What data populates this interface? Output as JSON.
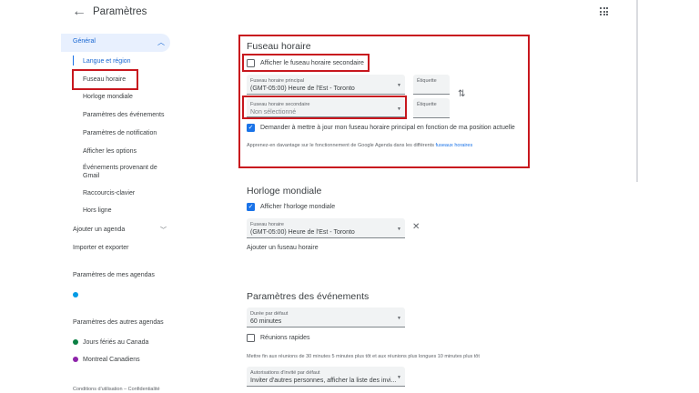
{
  "header": {
    "title": "Paramètres",
    "back_icon": "arrow-left-icon",
    "apps_icon": "apps-grid-icon"
  },
  "sidebar": {
    "general": "Général",
    "items": [
      "Langue et région",
      "Fuseau horaire",
      "Horloge mondiale",
      "Paramètres des événements",
      "Paramètres de notification",
      "Afficher les options",
      "Événements provenant de Gmail",
      "Raccourcis-clavier",
      "Hors ligne"
    ],
    "add_calendar": "Ajouter un agenda",
    "import_export": "Importer et exporter",
    "my_calendars_title": "Paramètres de mes agendas",
    "other_calendars_title": "Paramètres des autres agendas",
    "other_calendars": [
      {
        "name": "Jours fériés au Canada",
        "color": "#0b8043"
      },
      {
        "name": "Montreal Canadiens",
        "color": "#8e24aa"
      }
    ],
    "my_calendar_color": "#039be5",
    "footer": "Conditions d'utilisation – Confidentialité"
  },
  "timezone": {
    "title": "Fuseau horaire",
    "secondary_checkbox": "Afficher le fuseau horaire secondaire",
    "primary_label": "Fuseau horaire principal",
    "primary_value": "(GMT-05:00) Heure de l'Est - Toronto",
    "primary_tag": "Étiquette",
    "secondary_label": "Fuseau horaire secondaire",
    "secondary_value": "Non sélectionné",
    "secondary_tag": "Étiquette",
    "update_checkbox": "Demander à mettre à jour mon fuseau horaire principal en fonction de ma position actuelle",
    "learn_more": "Apprenez-en davantage sur le fonctionnement de Google Agenda dans les différents",
    "learn_more_link": "fuseaux horaires"
  },
  "world_clock": {
    "title": "Horloge mondiale",
    "show_checkbox": "Afficher l'horloge mondiale",
    "tz_label": "Fuseau horaire",
    "tz_value": "(GMT-05:00) Heure de l'Est - Toronto",
    "add": "Ajouter un fuseau horaire"
  },
  "events": {
    "title": "Paramètres des événements",
    "duration_label": "Durée par défaut",
    "duration_value": "60 minutes",
    "quick_meetings": "Réunions rapides",
    "quick_note": "Mettre fin aux réunions de 30 minutes 5 minutes plus tôt et aux réunions plus longues 10 minutes plus tôt",
    "invite_label": "Autorisations d'invité par défaut",
    "invite_value": "Inviter d'autres personnes, afficher la liste des invi..."
  },
  "colors": {
    "accent": "#1a73e8",
    "highlight": "#c8171e"
  }
}
